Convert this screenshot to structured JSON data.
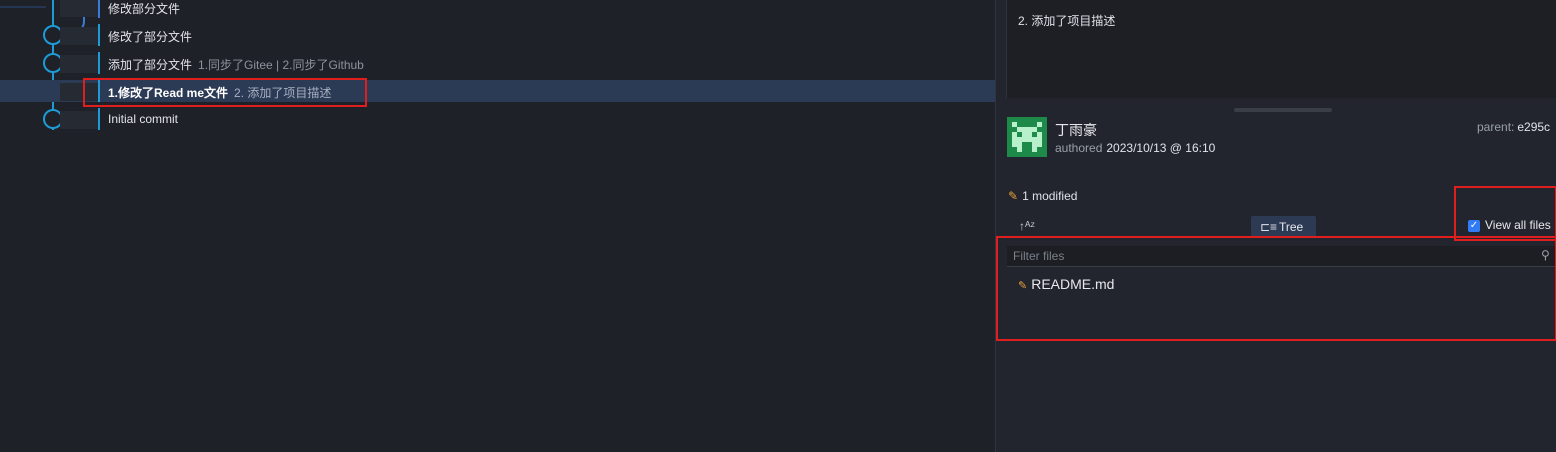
{
  "commits": [
    {
      "message": "修改部分文件",
      "sub": ""
    },
    {
      "message": "修改了部分文件",
      "sub": ""
    },
    {
      "message": "添加了部分文件",
      "sub": "1.同步了Gitee | 2.同步了Github"
    },
    {
      "message": "1.修改了Read me文件",
      "sub": "2. 添加了项目描述",
      "selected": true
    },
    {
      "message": "Initial commit",
      "sub": ""
    }
  ],
  "details": {
    "description": "2. 添加了项目描述",
    "author": "丁雨豪",
    "authored_label": "authored",
    "date": "2023/10/13 @ 16:10",
    "parent_label": "parent:",
    "parent_sha": "e295c"
  },
  "files": {
    "modified_summary": "1 modified",
    "tree_label": "Tree",
    "view_all_label": "View all files",
    "view_all_checked": true,
    "filter_placeholder": "Filter files",
    "items": [
      {
        "name": "README.md",
        "status": "modified"
      }
    ]
  },
  "colors": {
    "accent": "#2f7cf6",
    "graph_line": "#1e9bd7",
    "modified": "#e8a13a",
    "highlight": "#e01e1e"
  }
}
